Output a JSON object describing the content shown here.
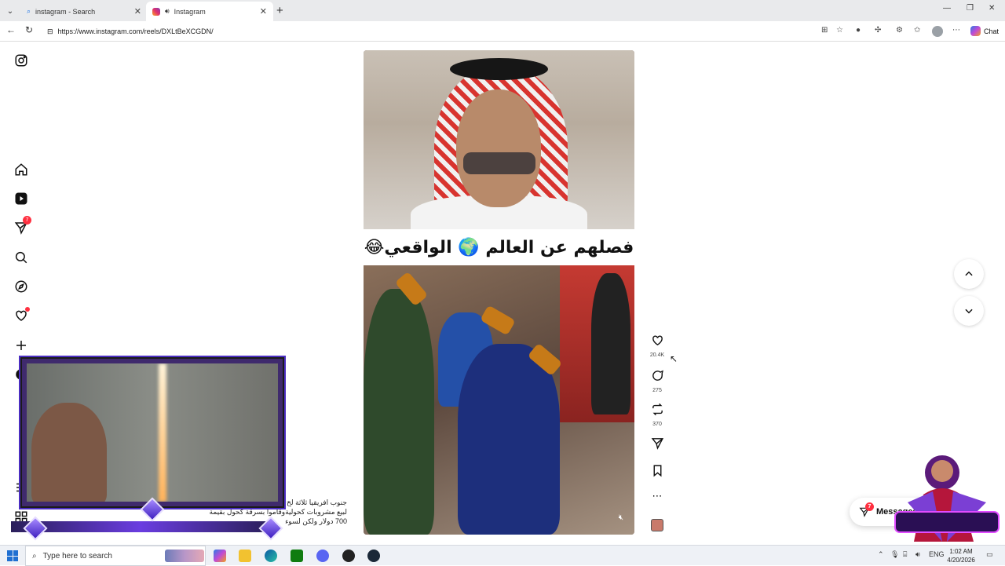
{
  "browser": {
    "tabs": [
      {
        "title": "instagram - Search",
        "active": false,
        "icon": "search-icon"
      },
      {
        "title": "Instagram",
        "active": true,
        "icon": "instagram-icon"
      }
    ],
    "url": "https://www.instagram.com/reels/DXLtBeXCGDN/",
    "chat_label": "Chat"
  },
  "sidebar": {
    "notifications_badge": "7"
  },
  "reel": {
    "caption": "فصلهم عن العالم 🌍 الواقعي😂",
    "description_lines": [
      "جنوب افريقيا ثلاثة لخ",
      "لبيع مشروبات كحوليةوقاموا بسرقة كحول بقيمة",
      "700 دولار ولكن لسوء"
    ]
  },
  "actions": {
    "likes": "20.4K",
    "comments": "275",
    "reposts": "370"
  },
  "messages": {
    "label": "Messages",
    "badge": "7"
  },
  "taskbar": {
    "search_placeholder": "Type here to search",
    "language": "ENG",
    "time": "1:02 AM",
    "date": "4/20/2026"
  },
  "colors": {
    "notification_red": "#ff3040",
    "overlay_purple": "#4b2ec2"
  }
}
